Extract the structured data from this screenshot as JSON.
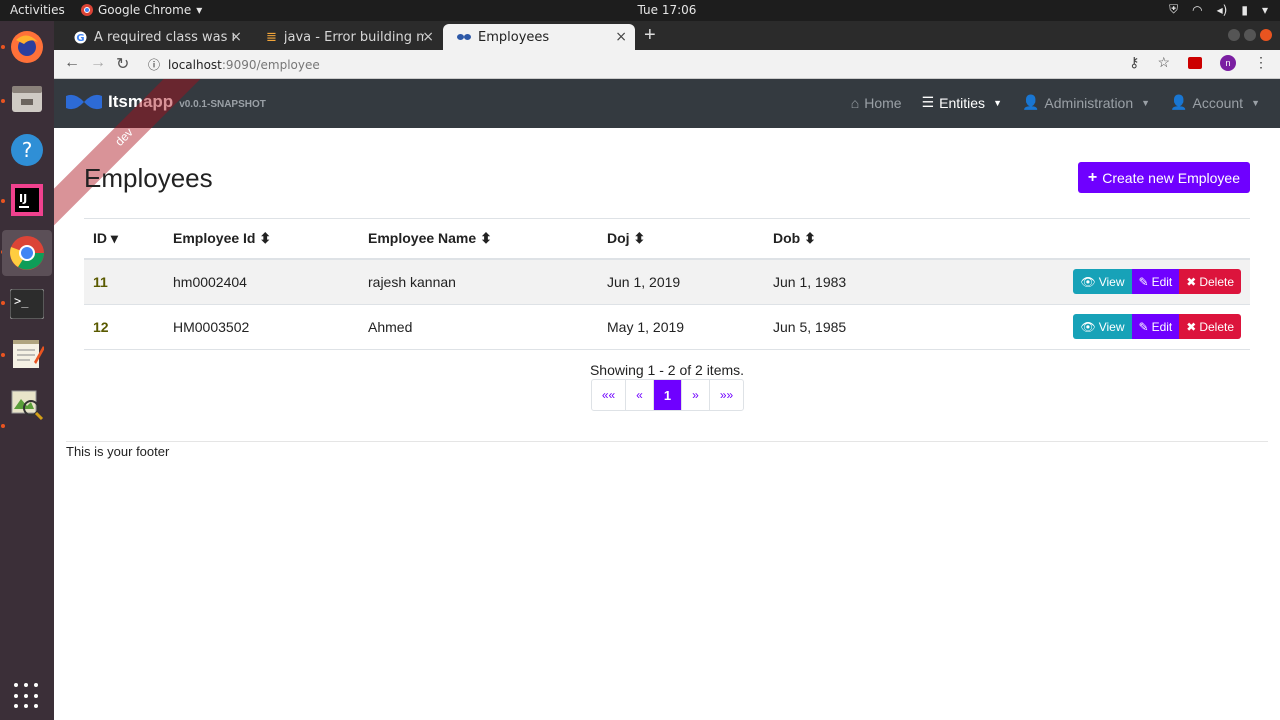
{
  "system_bar": {
    "activities": "Activities",
    "app_name": "Google Chrome",
    "clock": "Tue 17:06"
  },
  "browser": {
    "tabs": [
      {
        "title": "A required class was miss"
      },
      {
        "title": "java - Error building mave"
      },
      {
        "title": "Employees"
      }
    ],
    "url_host": "localhost",
    "url_path": ":9090/employee"
  },
  "navbar": {
    "brand": "Itsmapp",
    "version": "v0.0.1-SNAPSHOT",
    "ribbon": "dev",
    "items": {
      "home": "Home",
      "entities": "Entities",
      "administration": "Administration",
      "account": "Account"
    }
  },
  "page": {
    "title": "Employees",
    "create_button": "Create new Employee"
  },
  "table": {
    "headers": {
      "id": "ID",
      "employee_id": "Employee Id",
      "employee_name": "Employee Name",
      "doj": "Doj",
      "dob": "Dob"
    },
    "rows": [
      {
        "id": "11",
        "employee_id": "hm0002404",
        "employee_name": "rajesh kannan",
        "doj": "Jun 1, 2019",
        "dob": "Jun 1, 1983"
      },
      {
        "id": "12",
        "employee_id": "HM0003502",
        "employee_name": "Ahmed",
        "doj": "May 1, 2019",
        "dob": "Jun 5, 1985"
      }
    ],
    "actions": {
      "view": "View",
      "edit": "Edit",
      "delete": "Delete"
    }
  },
  "pagination": {
    "summary": "Showing 1 - 2 of 2 items.",
    "first": "««",
    "prev": "«",
    "current": "1",
    "next": "»",
    "last": "»»"
  },
  "footer": {
    "text": "This is your footer"
  },
  "colors": {
    "primary": "#6f00ff",
    "info": "#17a2b8",
    "danger": "#dc143c",
    "navbar": "#343a40"
  }
}
